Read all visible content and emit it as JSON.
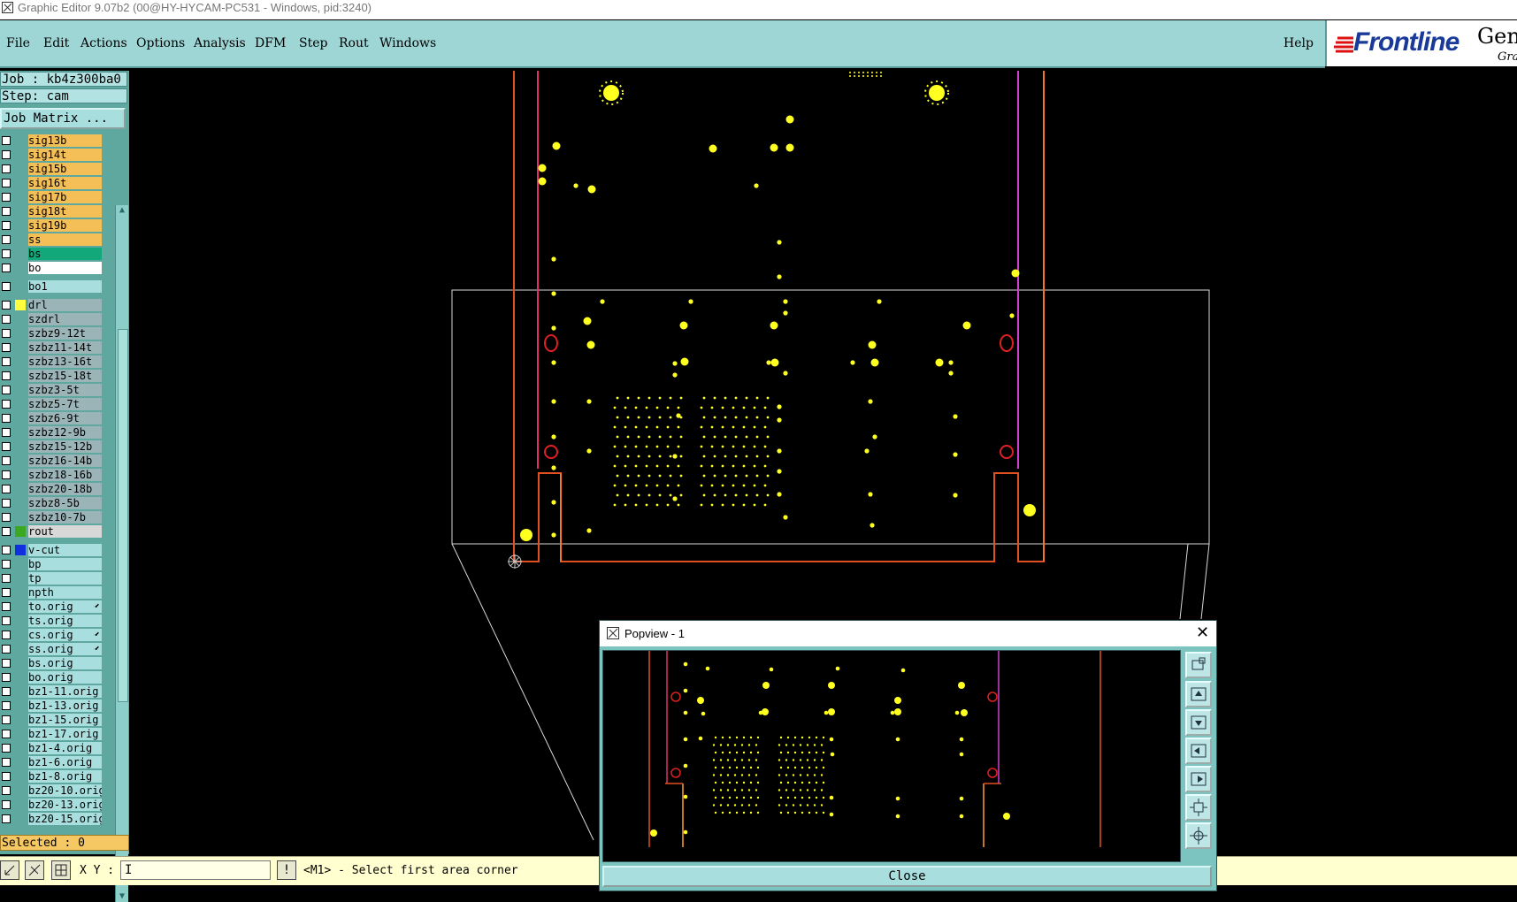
{
  "window": {
    "title": "Graphic Editor 9.07b2 (00@HY-HYCAM-PC531 - Windows, pid:3240)"
  },
  "menu": {
    "items": [
      "File",
      "Edit",
      "Actions",
      "Options",
      "Analysis",
      "DFM",
      "Step",
      "Rout",
      "Windows"
    ],
    "help": "Help"
  },
  "logo": {
    "brand": "Frontline",
    "right_text": "Gene",
    "sub_text": "Gra"
  },
  "job": {
    "job_line": "Job : kb4z300ba0",
    "step_line": "Step: cam",
    "matrix_button": "Job Matrix ..."
  },
  "layers": [
    {
      "name": "sig13b",
      "color": "#f5bf57",
      "swatch": ""
    },
    {
      "name": "sig14t",
      "color": "#f5bf57",
      "swatch": ""
    },
    {
      "name": "sig15b",
      "color": "#f5bf57",
      "swatch": ""
    },
    {
      "name": "sig16t",
      "color": "#f5bf57",
      "swatch": ""
    },
    {
      "name": "sig17b",
      "color": "#f5bf57",
      "swatch": ""
    },
    {
      "name": "sig18t",
      "color": "#f5bf57",
      "swatch": ""
    },
    {
      "name": "sig19b",
      "color": "#f5bf57",
      "swatch": ""
    },
    {
      "name": "ss",
      "color": "#f5bf57",
      "swatch": ""
    },
    {
      "name": "bs",
      "color": "#12a87a",
      "swatch": ""
    },
    {
      "name": "bo",
      "color": "#ffffff",
      "swatch": ""
    },
    {
      "name": "bo1",
      "color": "#a8dede",
      "swatch": "",
      "gap": true
    },
    {
      "name": "drl",
      "color": "#9ab4b8",
      "swatch": "#ffff40",
      "gap": true
    },
    {
      "name": "szdrl",
      "color": "#9ab4b8",
      "swatch": ""
    },
    {
      "name": "szbz9-12t",
      "color": "#9ab4b8",
      "swatch": ""
    },
    {
      "name": "szbz11-14t",
      "color": "#9ab4b8",
      "swatch": ""
    },
    {
      "name": "szbz13-16t",
      "color": "#9ab4b8",
      "swatch": ""
    },
    {
      "name": "szbz15-18t",
      "color": "#9ab4b8",
      "swatch": ""
    },
    {
      "name": "szbz3-5t",
      "color": "#9ab4b8",
      "swatch": ""
    },
    {
      "name": "szbz5-7t",
      "color": "#9ab4b8",
      "swatch": ""
    },
    {
      "name": "szbz6-9t",
      "color": "#9ab4b8",
      "swatch": ""
    },
    {
      "name": "szbz12-9b",
      "color": "#9ab4b8",
      "swatch": ""
    },
    {
      "name": "szbz15-12b",
      "color": "#9ab4b8",
      "swatch": ""
    },
    {
      "name": "szbz16-14b",
      "color": "#9ab4b8",
      "swatch": ""
    },
    {
      "name": "szbz18-16b",
      "color": "#9ab4b8",
      "swatch": ""
    },
    {
      "name": "szbz20-18b",
      "color": "#9ab4b8",
      "swatch": ""
    },
    {
      "name": "szbz8-5b",
      "color": "#9ab4b8",
      "swatch": ""
    },
    {
      "name": "szbz10-7b",
      "color": "#9ab4b8",
      "swatch": ""
    },
    {
      "name": "rout",
      "color": "#d8d8d8",
      "swatch": "#3aa820"
    },
    {
      "name": "v-cut",
      "color": "#a8dede",
      "swatch": "#1030e0",
      "gap": true
    },
    {
      "name": "bp",
      "color": "#a8dede",
      "swatch": ""
    },
    {
      "name": "tp",
      "color": "#a8dede",
      "swatch": ""
    },
    {
      "name": "npth",
      "color": "#a8dede",
      "swatch": ""
    },
    {
      "name": "to.orig",
      "color": "#a8dede",
      "swatch": "",
      "mark": "⬋"
    },
    {
      "name": "ts.orig",
      "color": "#a8dede",
      "swatch": ""
    },
    {
      "name": "cs.orig",
      "color": "#a8dede",
      "swatch": "",
      "mark": "⬋"
    },
    {
      "name": "ss.orig",
      "color": "#a8dede",
      "swatch": "",
      "mark": "⬋"
    },
    {
      "name": "bs.orig",
      "color": "#a8dede",
      "swatch": ""
    },
    {
      "name": "bo.orig",
      "color": "#a8dede",
      "swatch": ""
    },
    {
      "name": "bz1-11.orig",
      "color": "#a8dede",
      "swatch": ""
    },
    {
      "name": "bz1-13.orig",
      "color": "#a8dede",
      "swatch": ""
    },
    {
      "name": "bz1-15.orig",
      "color": "#a8dede",
      "swatch": ""
    },
    {
      "name": "bz1-17.orig",
      "color": "#a8dede",
      "swatch": ""
    },
    {
      "name": "bz1-4.orig",
      "color": "#a8dede",
      "swatch": ""
    },
    {
      "name": "bz1-6.orig",
      "color": "#a8dede",
      "swatch": ""
    },
    {
      "name": "bz1-8.orig",
      "color": "#a8dede",
      "swatch": ""
    },
    {
      "name": "bz20-10.orig",
      "color": "#a8dede",
      "swatch": ""
    },
    {
      "name": "bz20-13.orig",
      "color": "#a8dede",
      "swatch": ""
    },
    {
      "name": "bz20-15.orig",
      "color": "#a8dede",
      "swatch": ""
    }
  ],
  "status": {
    "selected": "Selected : 0",
    "xy_label": "X Y :",
    "xy_value": "I",
    "excl": "!",
    "message": "<M1> - Select first area corner"
  },
  "popview": {
    "title": "Popview - 1",
    "close_x": "✕",
    "close_button": "Close"
  }
}
